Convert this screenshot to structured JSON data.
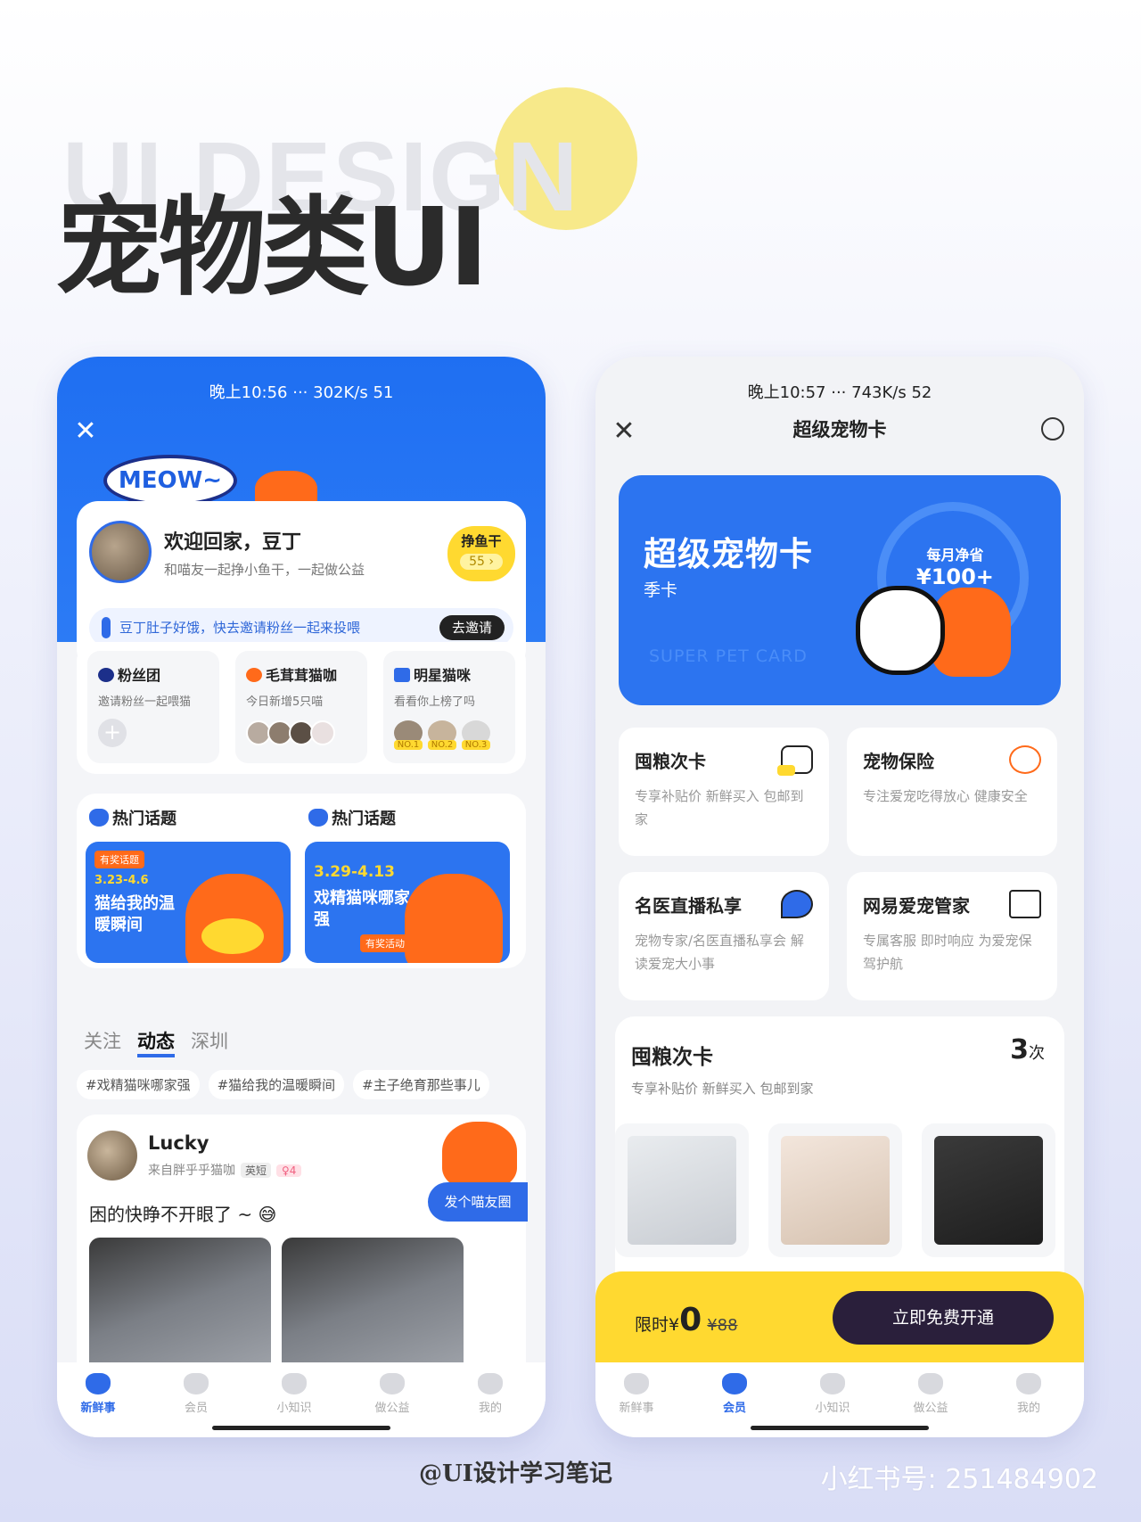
{
  "poster": {
    "bg_text": "UI DESIGN",
    "title": "宠物类UI",
    "credit": "@UI设计学习笔记",
    "watermark": "小红书号: 251484902"
  },
  "left": {
    "status_bar": "晚上10:56 ··· 302K/s 51",
    "meow": "MEOW~",
    "welcome": {
      "title": "欢迎回家，豆丁",
      "subtitle": "和喵友一起挣小鱼干，一起做公益",
      "earn_label": "挣鱼干",
      "earn_value": "55 ›"
    },
    "invite": {
      "text": "豆丁肚子好饿，快去邀请粉丝一起来投喂",
      "button": "去邀请"
    },
    "tiles": [
      {
        "title": "粉丝团",
        "subtitle": "邀请粉丝一起喂猫"
      },
      {
        "title": "毛茸茸猫咖",
        "subtitle": "今日新增5只喵"
      },
      {
        "title": "明星猫咪",
        "subtitle": "看看你上榜了吗",
        "ranks": [
          "NO.1",
          "NO.2",
          "NO.3"
        ]
      }
    ],
    "topics": [
      {
        "header": "热门话题",
        "tag": "有奖话题",
        "date": "3.23-4.6",
        "title": "猫给我的温暖瞬间"
      },
      {
        "header": "热门话题",
        "tag": "有奖活动",
        "date": "3.29-4.13",
        "title": "戏精猫咪哪家强"
      }
    ],
    "feed_tabs": [
      "关注",
      "动态",
      "深圳"
    ],
    "chips": [
      "#戏精猫咪哪家强",
      "#猫给我的温暖瞬间",
      "#主子绝育那些事儿"
    ],
    "post": {
      "name": "Lucky",
      "origin": "来自胖乎乎猫咖",
      "breed": "英短",
      "gender_age": "♀4",
      "text": "困的快睁不开眼了 ~ 😅",
      "moment_button": "发个喵友圈"
    },
    "tabbar": [
      "新鲜事",
      "会员",
      "小知识",
      "做公益",
      "我的"
    ]
  },
  "right": {
    "status_bar": "晚上10:57 ··· 743K/s 52",
    "nav_title": "超级宠物卡",
    "hero": {
      "title": "超级宠物卡",
      "subtitle": "季卡",
      "watermark": "SUPER PET CARD",
      "save_label": "每月净省",
      "save_value": "¥100+"
    },
    "features": [
      {
        "title": "囤粮次卡",
        "desc": "专享补贴价 新鲜买入 包邮到家"
      },
      {
        "title": "宠物保险",
        "desc": "专注爱宠吃得放心 健康安全"
      },
      {
        "title": "名医直播私享",
        "desc": "宠物专家/名医直播私享会 解读爱宠大小事"
      },
      {
        "title": "网易爱宠管家",
        "desc": "专属客服 即时响应 为爱宠保驾护航"
      }
    ],
    "pack": {
      "title": "囤粮次卡",
      "subtitle": "专享补贴价 新鲜买入 包邮到家",
      "count": "3",
      "count_unit": "次"
    },
    "buy": {
      "prefix": "限时",
      "currency": "¥",
      "price": "0",
      "old_price": "¥88",
      "button": "立即免费开通"
    },
    "tabbar": [
      "新鲜事",
      "会员",
      "小知识",
      "做公益",
      "我的"
    ]
  }
}
